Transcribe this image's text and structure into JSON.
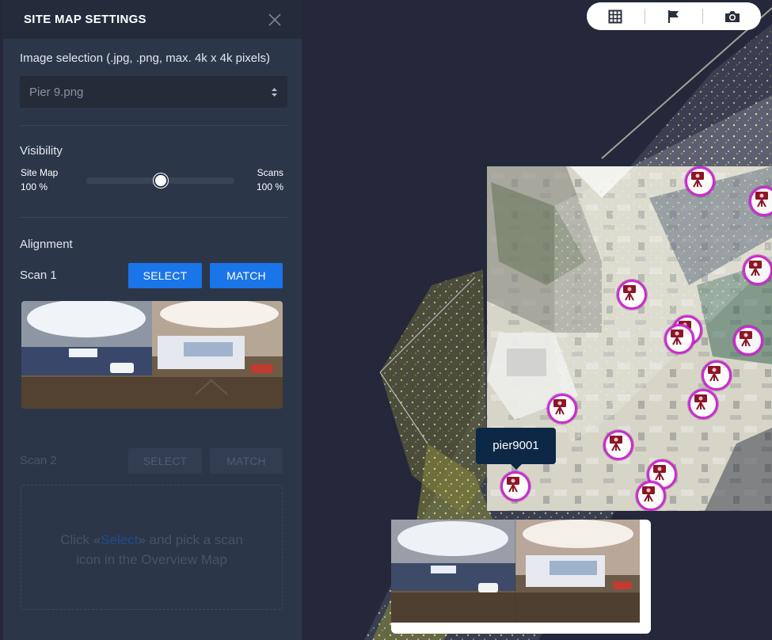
{
  "panel": {
    "title": "SITE MAP SETTINGS",
    "image_selection_label": "Image selection (.jpg, .png, max. 4k x 4k pixels)",
    "image_selected": "Pier 9.png",
    "visibility": {
      "label": "Visibility",
      "left_label": "Site Map",
      "left_value": "100 %",
      "right_label": "Scans",
      "right_value": "100 %",
      "slider_fraction": 0.5
    },
    "alignment_label": "Alignment",
    "scan1": {
      "label": "Scan 1",
      "select_label": "SELECT",
      "match_label": "MATCH"
    },
    "scan2": {
      "label": "Scan 2",
      "select_label": "SELECT",
      "match_label": "MATCH",
      "hint_prefix": "Click",
      "hint_link": "Select",
      "hint_suffix": "and pick a scan",
      "hint_line2": "icon in the Overview Map"
    }
  },
  "toolbar": {
    "icons": [
      "grid-icon",
      "flag-icon",
      "camera-icon"
    ]
  },
  "map": {
    "tooltip": "pier9001",
    "marker_color": "#c92ccf",
    "accent": "#1a75e8"
  }
}
